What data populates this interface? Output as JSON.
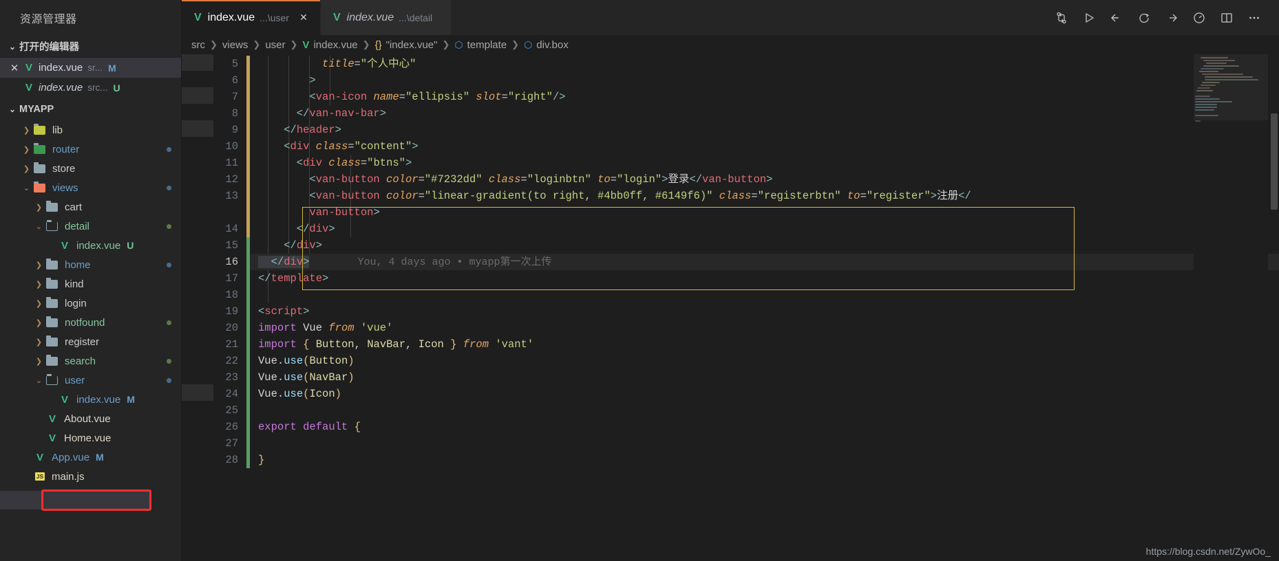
{
  "sidebar": {
    "title": "资源管理器",
    "open_editors": {
      "label": "打开的编辑器",
      "items": [
        {
          "name": "index.vue",
          "path": "sr...",
          "badge": "M",
          "active": true,
          "italic": false
        },
        {
          "name": "index.vue",
          "path": "src...",
          "badge": "U",
          "active": false,
          "italic": true
        }
      ]
    },
    "project": {
      "label": "MYAPP",
      "items": [
        {
          "label": "lib",
          "type": "folder",
          "icon": "folder-lib-icon",
          "expanded": false,
          "indent": 1,
          "dot": "",
          "badge": "",
          "color": "c-cream"
        },
        {
          "label": "router",
          "type": "folder",
          "icon": "folder-router-icon",
          "expanded": false,
          "indent": 1,
          "dot": "blue",
          "badge": "",
          "color": "c-blue"
        },
        {
          "label": "store",
          "type": "folder",
          "icon": "folder-icon",
          "expanded": false,
          "indent": 1,
          "dot": "",
          "badge": "",
          "color": "c-plain"
        },
        {
          "label": "views",
          "type": "folder",
          "icon": "folder-views-icon",
          "expanded": true,
          "indent": 1,
          "dot": "blue",
          "badge": "",
          "color": "c-blue"
        },
        {
          "label": "cart",
          "type": "folder",
          "icon": "folder-icon",
          "expanded": false,
          "indent": 2,
          "dot": "",
          "badge": "",
          "color": "c-plain"
        },
        {
          "label": "detail",
          "type": "folder",
          "icon": "folder-open-icon",
          "expanded": true,
          "indent": 2,
          "dot": "green",
          "badge": "",
          "color": "c-green"
        },
        {
          "label": "index.vue",
          "type": "vue",
          "icon": "vue-file-icon",
          "expanded": false,
          "indent": 3,
          "dot": "",
          "badge": "U",
          "color": "c-green"
        },
        {
          "label": "home",
          "type": "folder",
          "icon": "folder-icon",
          "expanded": false,
          "indent": 2,
          "dot": "blue",
          "badge": "",
          "color": "c-blue"
        },
        {
          "label": "kind",
          "type": "folder",
          "icon": "folder-icon",
          "expanded": false,
          "indent": 2,
          "dot": "",
          "badge": "",
          "color": "c-plain"
        },
        {
          "label": "login",
          "type": "folder",
          "icon": "folder-icon",
          "expanded": false,
          "indent": 2,
          "dot": "",
          "badge": "",
          "color": "c-plain"
        },
        {
          "label": "notfound",
          "type": "folder",
          "icon": "folder-icon",
          "expanded": false,
          "indent": 2,
          "dot": "green",
          "badge": "",
          "color": "c-green"
        },
        {
          "label": "register",
          "type": "folder",
          "icon": "folder-icon",
          "expanded": false,
          "indent": 2,
          "dot": "",
          "badge": "",
          "color": "c-plain"
        },
        {
          "label": "search",
          "type": "folder",
          "icon": "folder-icon",
          "expanded": false,
          "indent": 2,
          "dot": "green",
          "badge": "",
          "color": "c-green"
        },
        {
          "label": "user",
          "type": "folder",
          "icon": "folder-open-icon",
          "expanded": true,
          "indent": 2,
          "dot": "blue",
          "badge": "",
          "color": "c-blue"
        },
        {
          "label": "index.vue",
          "type": "vue",
          "icon": "vue-file-icon",
          "expanded": false,
          "indent": 3,
          "dot": "",
          "badge": "M",
          "color": "c-blue",
          "highlighted": true
        },
        {
          "label": "About.vue",
          "type": "vue",
          "icon": "vue-file-icon",
          "expanded": false,
          "indent": 2,
          "dot": "",
          "badge": "",
          "color": "c-cream"
        },
        {
          "label": "Home.vue",
          "type": "vue",
          "icon": "vue-file-icon",
          "expanded": false,
          "indent": 2,
          "dot": "",
          "badge": "",
          "color": "c-cream"
        },
        {
          "label": "App.vue",
          "type": "vue",
          "icon": "vue-file-icon",
          "expanded": false,
          "indent": 1,
          "dot": "",
          "badge": "M",
          "color": "c-blue"
        },
        {
          "label": "main.js",
          "type": "js",
          "icon": "js-file-icon",
          "expanded": false,
          "indent": 1,
          "dot": "",
          "badge": "",
          "color": "c-cream"
        }
      ]
    }
  },
  "tabs": [
    {
      "name": "index.vue",
      "path": "...\\user",
      "active": true,
      "closable": true
    },
    {
      "name": "index.vue",
      "path": "...\\detail",
      "active": false,
      "closable": false
    }
  ],
  "toolbar": {
    "icons": [
      {
        "name": "split-branch-icon",
        "label": "Source Control Graph"
      },
      {
        "name": "run-play-icon",
        "label": "Run"
      },
      {
        "name": "go-back-icon",
        "label": "Go Back"
      },
      {
        "name": "record-circle-icon",
        "label": "Record"
      },
      {
        "name": "go-forward-icon",
        "label": "Go Forward"
      },
      {
        "name": "performance-icon",
        "label": "Profile"
      },
      {
        "name": "split-editor-icon",
        "label": "Split Editor"
      },
      {
        "name": "more-actions-icon",
        "label": "More Actions"
      }
    ]
  },
  "breadcrumb": [
    {
      "label": "src",
      "icon": ""
    },
    {
      "label": "views",
      "icon": ""
    },
    {
      "label": "user",
      "icon": ""
    },
    {
      "label": "index.vue",
      "icon": "vue-icon"
    },
    {
      "label": "\"index.vue\"",
      "icon": "braces-icon"
    },
    {
      "label": "template",
      "icon": "cube-icon"
    },
    {
      "label": "div.box",
      "icon": "cube-icon"
    }
  ],
  "editor": {
    "first_line": 5,
    "lines": [
      {
        "n": 5,
        "change": "mod"
      },
      {
        "n": 6,
        "change": "mod"
      },
      {
        "n": 7,
        "change": "mod"
      },
      {
        "n": 8,
        "change": "mod"
      },
      {
        "n": 9,
        "change": "mod"
      },
      {
        "n": 10,
        "change": "mod"
      },
      {
        "n": 11,
        "change": "mod"
      },
      {
        "n": 12,
        "change": "mod"
      },
      {
        "n": 13,
        "change": "mod"
      },
      {
        "n": 14,
        "change": "mod"
      },
      {
        "n": 15,
        "change": "add"
      },
      {
        "n": 16,
        "change": "add",
        "active": true
      },
      {
        "n": 17,
        "change": "add"
      },
      {
        "n": 18,
        "change": "add"
      },
      {
        "n": 19,
        "change": "add"
      },
      {
        "n": 20,
        "change": "add"
      },
      {
        "n": 21,
        "change": "add"
      },
      {
        "n": 22,
        "change": "add"
      },
      {
        "n": 23,
        "change": "add"
      },
      {
        "n": 24,
        "change": "add"
      },
      {
        "n": 25,
        "change": "add"
      },
      {
        "n": 26,
        "change": "add"
      },
      {
        "n": 27,
        "change": "add"
      },
      {
        "n": 28,
        "change": "add"
      }
    ],
    "code_text": {
      "l5": "          title=\"个人中心\"",
      "l6": "        >",
      "l7": "        <van-icon name=\"ellipsis\" slot=\"right\"/>",
      "l8": "      </van-nav-bar>",
      "l9": "    </header>",
      "l10": "    <div class=\"content\">",
      "l11": "      <div class=\"btns\">",
      "l12": "        <van-button color=\"#7232dd\" class=\"loginbtn\" to=\"login\">登录</van-button>",
      "l13a": "        <van-button color=\"linear-gradient(to right, #4bb0ff, #6149f6)\" class=\"registerbtn\" to=\"register\">注册</",
      "l13b": "        van-button>",
      "l14": "      </div>",
      "l15": "    </div>",
      "l16": "  </div>",
      "l17": "</template>",
      "l18": "",
      "l19": "<script>",
      "l20": "import Vue from 'vue'",
      "l21": "import { Button, NavBar, Icon } from 'vant'",
      "l22": "Vue.use(Button)",
      "l23": "Vue.use(NavBar)",
      "l24": "Vue.use(Icon)",
      "l25": "",
      "l26": "export default {",
      "l27": "",
      "l28": "}"
    },
    "blame": "You, 4 days ago • myapp第一次上传",
    "colors": {
      "login_button_color": "#7232dd",
      "register_gradient_from": "#4bb0ff",
      "register_gradient_to": "#6149f6",
      "selection_border": "#d7ba3e",
      "highlight_border": "#ff2d2d"
    }
  },
  "watermark": "https://blog.csdn.net/ZywOo_"
}
